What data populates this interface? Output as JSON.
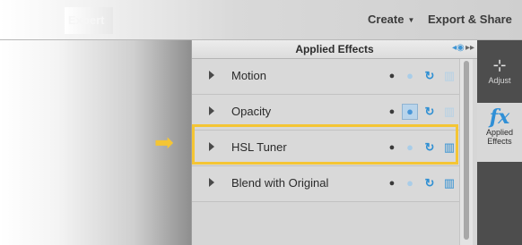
{
  "top_bar": {
    "export_tab": "Expert",
    "create_menu": "Create",
    "export_menu": "Export & Share"
  },
  "panel": {
    "title": "Applied Effects",
    "effects": [
      {
        "name": "Motion",
        "trash_active": false,
        "drop_active": false
      },
      {
        "name": "Opacity",
        "trash_active": false,
        "drop_active": true
      },
      {
        "name": "HSL Tuner",
        "trash_active": true,
        "drop_active": false
      },
      {
        "name": "Blend with Original",
        "trash_active": true,
        "drop_active": false
      }
    ]
  },
  "side_strip": {
    "adjust_label": "Adjust",
    "applied_label_line1": "Applied",
    "applied_label_line2": "Effects"
  },
  "icons": {
    "eye": "eye-icon",
    "drop": "drop-icon",
    "reset": "reset-icon",
    "trash": "trash-icon",
    "arrow": "arrow-right-icon"
  },
  "colors": {
    "highlight": "#f4c534",
    "accent_blue": "#2e8fd3"
  }
}
